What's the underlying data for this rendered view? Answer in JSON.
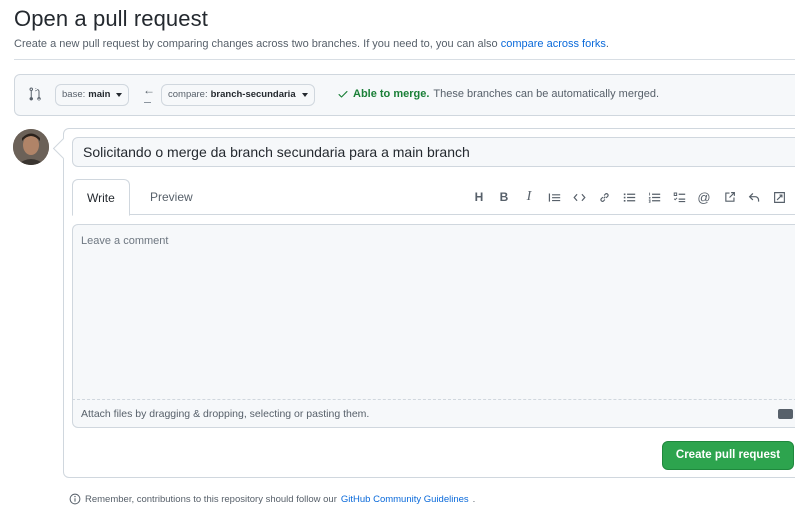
{
  "header": {
    "title": "Open a pull request",
    "subtitle": "Create a new pull request by comparing changes across two branches. If you need to, you can also ",
    "subtitle_link": "compare across forks",
    "subtitle_end": "."
  },
  "compare": {
    "base_label": "base:",
    "base_value": "main",
    "compare_label": "compare:",
    "compare_value": "branch-secundaria",
    "merge_ok": "Able to merge.",
    "merge_desc": "These branches can be automatically merged."
  },
  "form": {
    "title_value": "Solicitando o merge da branch secundaria para a main branch",
    "tabs": [
      "Write",
      "Preview"
    ],
    "toolbar_icons": [
      "heading-icon",
      "bold-icon",
      "italic-icon",
      "quote-icon",
      "code-icon",
      "link-icon",
      "unordered-list-icon",
      "ordered-list-icon",
      "task-list-icon",
      "mention-icon",
      "cross-reference-icon",
      "reply-icon",
      "fullscreen-icon"
    ],
    "comment_placeholder": "Leave a comment",
    "attach_text": "Attach files by dragging & dropping, selecting or pasting them.",
    "submit_label": "Create pull request"
  },
  "footer": {
    "note": "Remember, contributions to this repository should follow our ",
    "link": "GitHub Community Guidelines",
    "end": "."
  },
  "colors": {
    "accent_blue": "#0969da",
    "success_green": "#1a7f37",
    "button_green": "#2da44e"
  }
}
